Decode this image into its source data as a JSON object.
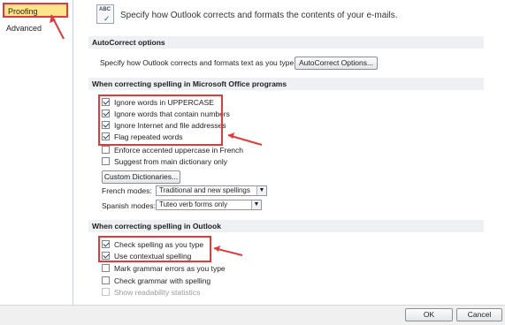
{
  "nav": {
    "items": [
      {
        "label": "Proofing"
      },
      {
        "label": "Advanced"
      }
    ]
  },
  "header": {
    "icon_label": "ABC",
    "description": "Specify how Outlook corrects and formats the contents of your e-mails."
  },
  "autocorrect": {
    "title": "AutoCorrect options",
    "text": "Specify how Outlook corrects and formats text as you type.",
    "button": "AutoCorrect Options..."
  },
  "office_spelling": {
    "title": "When correcting spelling in Microsoft Office programs",
    "options": [
      {
        "label": "Ignore words in UPPERCASE",
        "checked": true
      },
      {
        "label": "Ignore words that contain numbers",
        "checked": true
      },
      {
        "label": "Ignore Internet and file addresses",
        "checked": true
      },
      {
        "label": "Flag repeated words",
        "checked": true
      },
      {
        "label": "Enforce accented uppercase in French",
        "checked": false
      },
      {
        "label": "Suggest from main dictionary only",
        "checked": false
      }
    ],
    "custom_dictionaries_button": "Custom Dictionaries...",
    "french_modes_label": "French modes:",
    "french_modes_value": "Traditional and new spellings",
    "spanish_modes_label": "Spanish modes:",
    "spanish_modes_value": "Tuteo verb forms only"
  },
  "outlook_spelling": {
    "title": "When correcting spelling in Outlook",
    "options": [
      {
        "label": "Check spelling as you type",
        "checked": true
      },
      {
        "label": "Use contextual spelling",
        "checked": true
      },
      {
        "label": "Mark grammar errors as you type",
        "checked": false
      },
      {
        "label": "Check grammar with spelling",
        "checked": false
      },
      {
        "label": "Show readability statistics",
        "checked": false,
        "disabled": true
      }
    ]
  },
  "footer": {
    "ok": "OK",
    "cancel": "Cancel"
  },
  "colors": {
    "highlight": "#e03a3a",
    "selected_bg": "#fde58b"
  }
}
